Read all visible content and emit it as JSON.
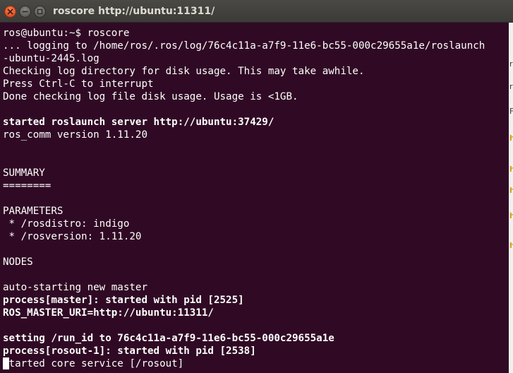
{
  "window": {
    "title": "roscore http://ubuntu:11311/"
  },
  "terminal": {
    "lines": [
      {
        "text": "ros@ubuntu:~$ roscore",
        "bold": false
      },
      {
        "text": "... logging to /home/ros/.ros/log/76c4c11a-a7f9-11e6-bc55-000c29655a1e/roslaunch",
        "bold": false
      },
      {
        "text": "-ubuntu-2445.log",
        "bold": false
      },
      {
        "text": "Checking log directory for disk usage. This may take awhile.",
        "bold": false
      },
      {
        "text": "Press Ctrl-C to interrupt",
        "bold": false
      },
      {
        "text": "Done checking log file disk usage. Usage is <1GB.",
        "bold": false
      },
      {
        "text": "",
        "bold": false
      },
      {
        "text": "started roslaunch server http://ubuntu:37429/",
        "bold": true
      },
      {
        "text": "ros_comm version 1.11.20",
        "bold": false
      },
      {
        "text": "",
        "bold": false
      },
      {
        "text": "",
        "bold": false
      },
      {
        "text": "SUMMARY",
        "bold": false
      },
      {
        "text": "========",
        "bold": false
      },
      {
        "text": "",
        "bold": false
      },
      {
        "text": "PARAMETERS",
        "bold": false
      },
      {
        "text": " * /rosdistro: indigo",
        "bold": false
      },
      {
        "text": " * /rosversion: 1.11.20",
        "bold": false
      },
      {
        "text": "",
        "bold": false
      },
      {
        "text": "NODES",
        "bold": false
      },
      {
        "text": "",
        "bold": false
      },
      {
        "text": "auto-starting new master",
        "bold": false
      },
      {
        "text": "process[master]: started with pid [2525]",
        "bold": true
      },
      {
        "text": "ROS_MASTER_URI=http://ubuntu:11311/",
        "bold": true
      },
      {
        "text": "",
        "bold": false
      },
      {
        "text": "setting /run_id to 76c4c11a-a7f9-11e6-bc55-000c29655a1e",
        "bold": true
      },
      {
        "text": "process[rosout-1]: started with pid [2538]",
        "bold": true
      },
      {
        "text": "started core service [/rosout]",
        "bold": false
      }
    ]
  },
  "edge_marks": [
    {
      "text": "r",
      "hl": false
    },
    {
      "text": "r",
      "hl": false
    },
    {
      "text": "F",
      "hl": false
    },
    {
      "text": "h",
      "hl": true
    },
    {
      "text": "h",
      "hl": true
    },
    {
      "text": "h",
      "hl": true
    },
    {
      "text": "h",
      "hl": true
    },
    {
      "text": "h",
      "hl": true
    }
  ],
  "colors": {
    "terminal_bg": "#300a24",
    "terminal_fg": "#ffffff",
    "titlebar_bg": "#3c3b37",
    "close_button": "#e05a2b"
  }
}
